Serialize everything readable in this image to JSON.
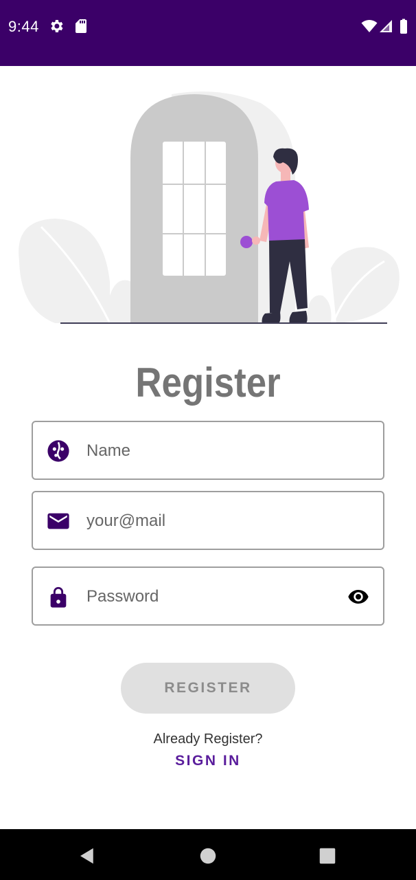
{
  "status_bar": {
    "time": "9:44",
    "left_icons": [
      "gear-icon",
      "sd-card-icon"
    ],
    "right_icons": [
      "wifi-icon",
      "signal-icon",
      "battery-icon"
    ],
    "background_color": "#3b0068"
  },
  "illustration": {
    "icon": "person-at-door-illustration",
    "accent_color": "#9c4fd4"
  },
  "form": {
    "title": "Register",
    "name_field": {
      "placeholder": "Name",
      "icon": "face-icon"
    },
    "email_field": {
      "placeholder": "your@mail",
      "icon": "mail-icon"
    },
    "password_field": {
      "placeholder": "Password",
      "icon": "lock-icon",
      "toggle_icon": "eye-icon"
    },
    "accent_color": "#3b0068"
  },
  "register_button": {
    "label": "REGISTER",
    "state": "disabled"
  },
  "footer": {
    "prompt": "Already Register?",
    "signin_label": "SIGN IN",
    "signin_color": "#5a1d9c"
  },
  "nav_bar": {
    "icons": [
      "back-icon",
      "home-icon",
      "recents-icon"
    ]
  }
}
